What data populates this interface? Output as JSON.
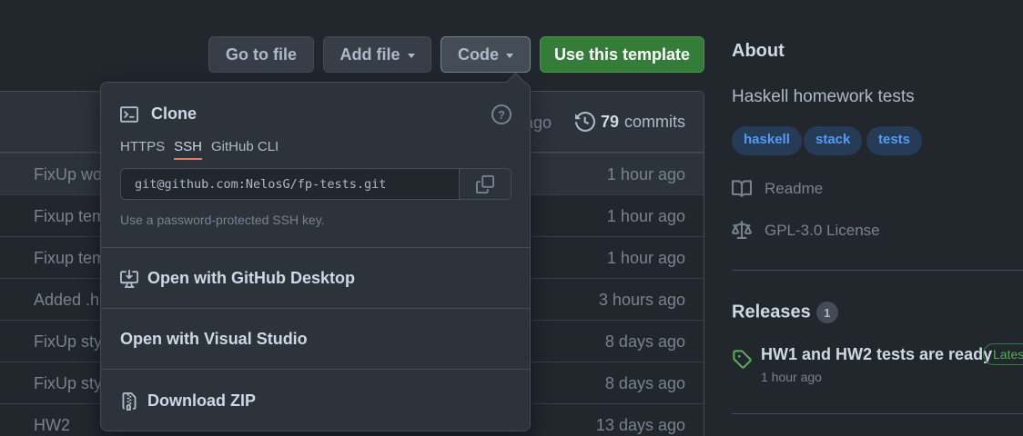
{
  "toolbar": {
    "goto_file": "Go to file",
    "add_file": "Add file",
    "code": "Code",
    "use_template": "Use this template"
  },
  "panel": {
    "header_ago": "ago",
    "commits_count": "79",
    "commits_label": "commits"
  },
  "files": [
    {
      "msg": "FixUp wo",
      "time": "1 hour ago"
    },
    {
      "msg": "Fixup tem",
      "time": "1 hour ago"
    },
    {
      "msg": "Fixup tem",
      "time": "1 hour ago"
    },
    {
      "msg": "Added .hi",
      "time": "3 hours ago"
    },
    {
      "msg": "FixUp styl",
      "time": "8 days ago"
    },
    {
      "msg": "FixUp styl",
      "time": "8 days ago"
    },
    {
      "msg": "HW2",
      "time": "13 days ago"
    }
  ],
  "dropdown": {
    "title": "Clone",
    "tabs": [
      "HTTPS",
      "SSH",
      "GitHub CLI"
    ],
    "url": "git@github.com:NelosG/fp-tests.git",
    "hint": "Use a password-protected SSH key.",
    "open_desktop": "Open with GitHub Desktop",
    "open_vs": "Open with Visual Studio",
    "download_zip": "Download ZIP"
  },
  "about": {
    "heading": "About",
    "description": "Haskell homework tests",
    "topics": [
      "haskell",
      "stack",
      "tests"
    ],
    "readme": "Readme",
    "license": "GPL-3.0 License"
  },
  "releases": {
    "heading": "Releases",
    "count": "1",
    "title": "HW1 and HW2 tests are ready",
    "time": "1 hour ago",
    "badge": "Lates"
  },
  "colors": {
    "background": "#22272e",
    "accent_green": "#347d39",
    "link_blue": "#539bf5",
    "tab_underline": "#ec775c"
  }
}
